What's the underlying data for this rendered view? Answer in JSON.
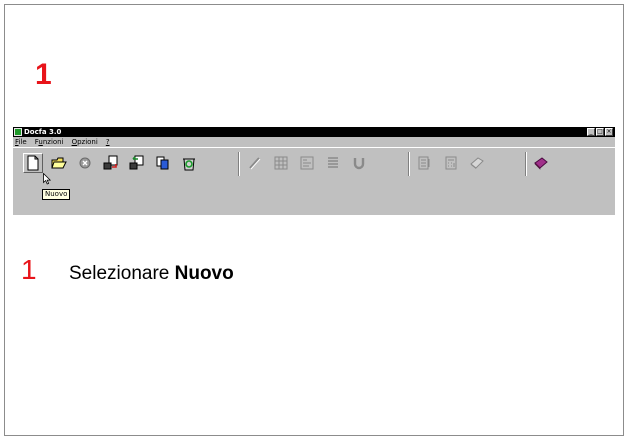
{
  "slide": {
    "step_heading": "1",
    "instruction": {
      "number": "1",
      "prefix": "Selezionare ",
      "target": "Nuovo"
    }
  },
  "app": {
    "title": "Docfa 3.0",
    "window_buttons": [
      "_",
      "□",
      "×"
    ],
    "menu": [
      {
        "accel": "F",
        "rest": "ile"
      },
      {
        "pre": "F",
        "accel": "u",
        "rest": "nzioni"
      },
      {
        "accel": "O",
        "rest": "pzioni"
      },
      {
        "accel": "?",
        "rest": ""
      }
    ],
    "tooltip": "Nuovo",
    "toolbar_icons": [
      "new-document-icon",
      "open-folder-icon",
      "delete-icon",
      "export-icon",
      "import-icon",
      "copy-icon",
      "recycle-icon",
      "edit-brush-icon",
      "grid-icon",
      "form-icon",
      "list-icon",
      "magnet-icon",
      "report-icon",
      "calculator-icon",
      "printer-icon",
      "help-book-icon"
    ],
    "colors": {
      "accent_red": "#e8141a",
      "window_bg": "#c0c0c0",
      "titlebar": "#000000"
    }
  }
}
